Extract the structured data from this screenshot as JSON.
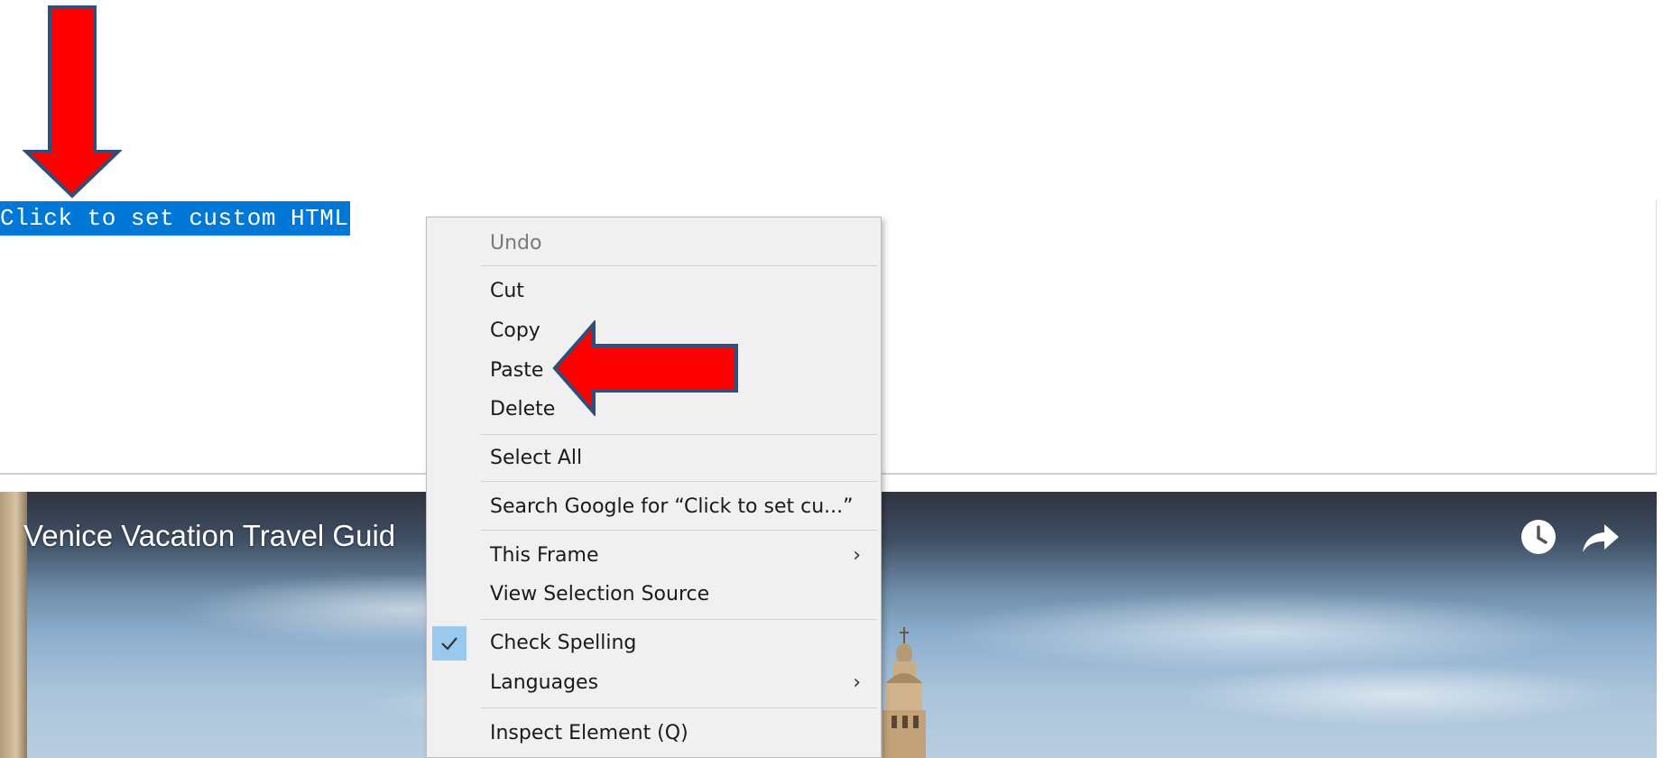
{
  "editor": {
    "selected_text": "Click to set custom HTML"
  },
  "video": {
    "title": "Venice Vacation Travel Guid",
    "icons": [
      "watch-later-icon",
      "share-icon"
    ]
  },
  "context_menu": {
    "items": [
      {
        "label": "Undo",
        "enabled": false
      },
      {
        "label": "Cut"
      },
      {
        "label": "Copy"
      },
      {
        "label": "Paste"
      },
      {
        "label": "Delete"
      },
      {
        "label": "Select All"
      },
      {
        "label": "Search Google for “Click to set cu...”"
      },
      {
        "label": "This Frame",
        "submenu": true
      },
      {
        "label": "View Selection Source"
      },
      {
        "label": "Check Spelling",
        "checked": true
      },
      {
        "label": "Languages",
        "submenu": true
      },
      {
        "label": "Inspect Element (Q)"
      }
    ],
    "submenu_arrow": "›"
  },
  "annotations": {
    "arrow_color": "#ff0000",
    "arrow_outline": "#2f4f7a"
  },
  "colors": {
    "selection": "#0078d7",
    "menu_bg": "#f0f0f0",
    "check_highlight": "#99c9ef"
  }
}
